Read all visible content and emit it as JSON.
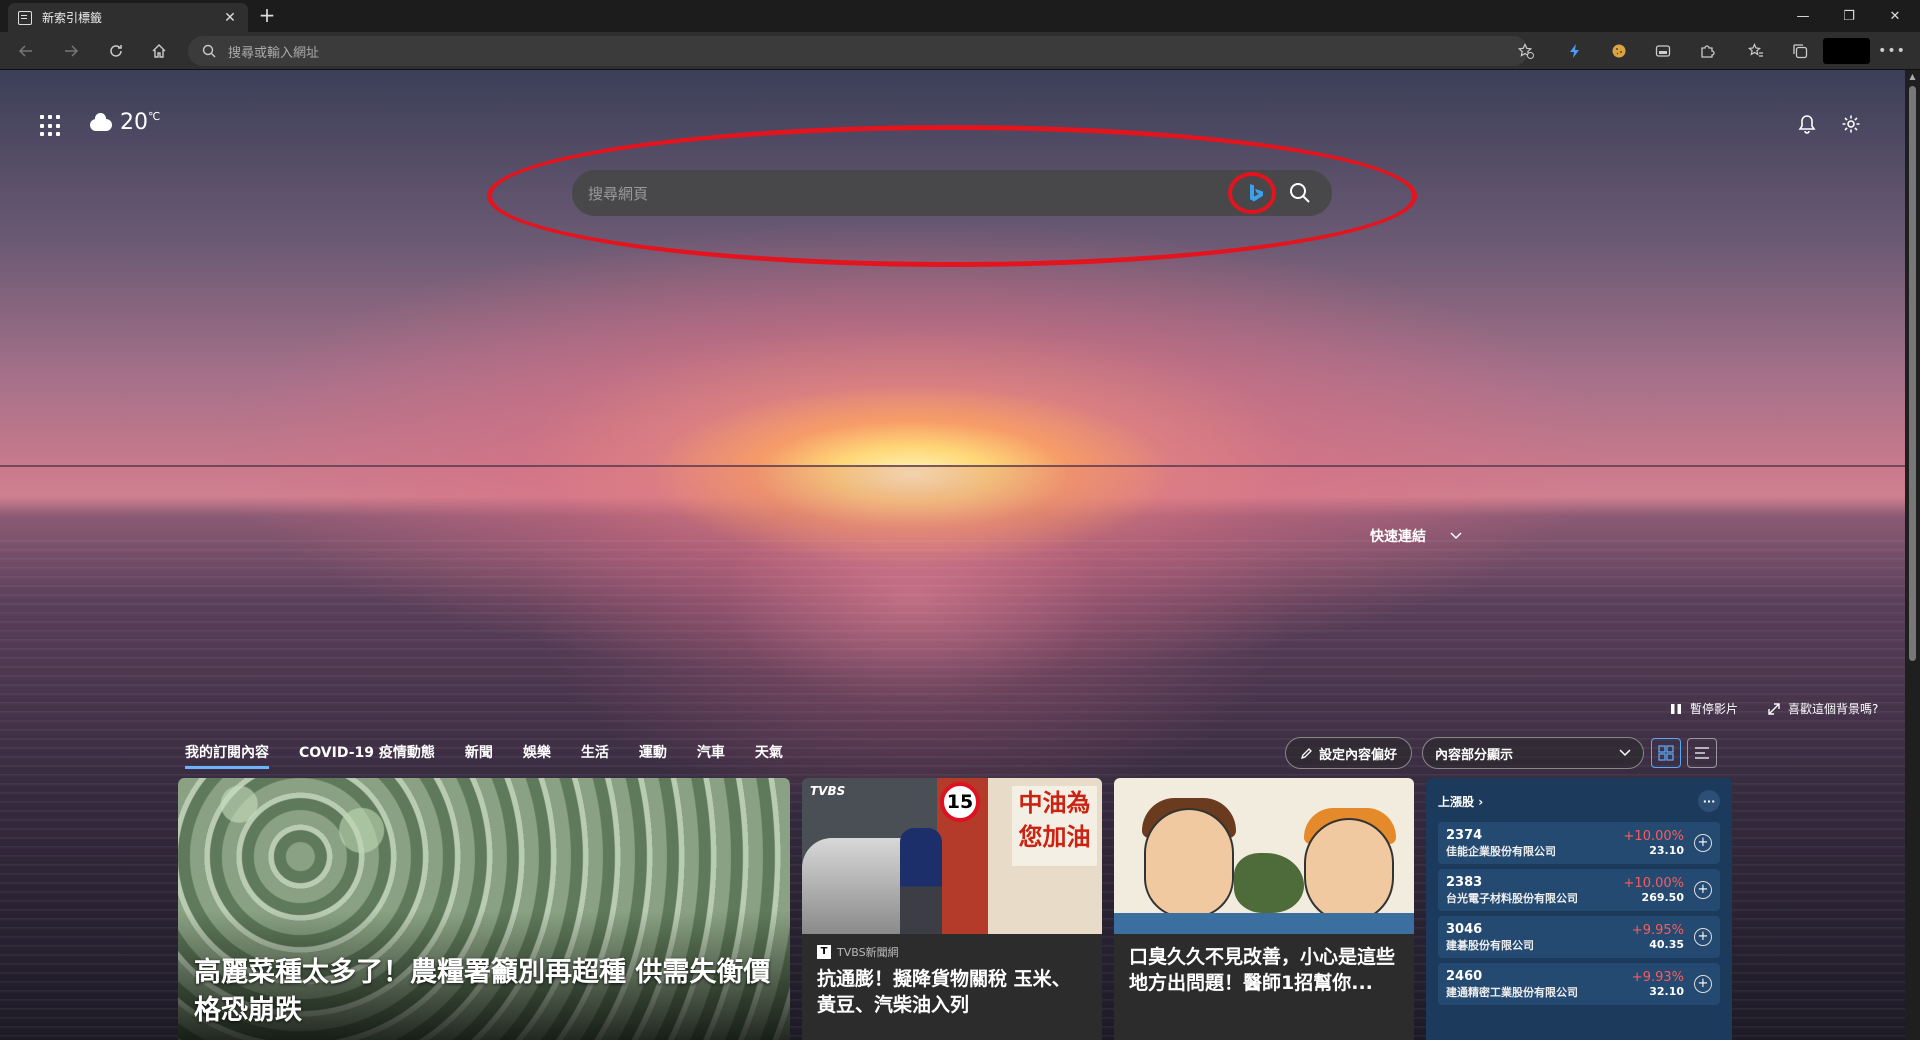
{
  "browser": {
    "tab_title": "新索引標籤",
    "tab_close": "✕",
    "new_tab": "+",
    "address_placeholder": "搜尋或輸入網址",
    "window_controls": {
      "minimize": "—",
      "restore": "❐",
      "close": "✕"
    }
  },
  "ntp": {
    "weather": {
      "temperature": "20",
      "unit": "℃",
      "condition_icon": "cloud-icon"
    },
    "search": {
      "placeholder": "搜尋網頁"
    },
    "quick_links_label": "快速連結",
    "pause_video_label": "暫停影片",
    "like_background_label": "喜歡這個背景嗎?"
  },
  "feed": {
    "nav": [
      "我的訂閱內容",
      "COVID-19 疫情動態",
      "新聞",
      "娛樂",
      "生活",
      "運動",
      "汽車",
      "天氣"
    ],
    "preferences_label": "設定內容偏好",
    "layout_select": "內容部分顯示",
    "cards": {
      "big_headline": "高麗菜種太多了！農糧署籲別再超種 供需失衡價格恐崩跌",
      "fuel": {
        "source": "TVBS新聞網",
        "title": "抗通膨！擬降貨物關稅 玉米、黃豆、汽柴油入列",
        "badge": "15",
        "sign_text": "中油為您加油",
        "watermark": "TVBS"
      },
      "cartoon": {
        "title": "口臭久久不見改善，小心是這些地方出問題！醫師1招幫你..."
      }
    }
  },
  "stocks": {
    "title": "上漲股",
    "more": "···",
    "rows": [
      {
        "code": "2374",
        "name": "佳能企業股份有限公司",
        "change": "+10.00%",
        "price": "23.10"
      },
      {
        "code": "2383",
        "name": "台光電子材料股份有限公司",
        "change": "+10.00%",
        "price": "269.50"
      },
      {
        "code": "3046",
        "name": "建碁股份有限公司",
        "change": "+9.95%",
        "price": "40.35"
      },
      {
        "code": "2460",
        "name": "建通精密工業股份有限公司",
        "change": "+9.93%",
        "price": "32.10"
      }
    ],
    "accent_up": "#ff5a5a"
  }
}
